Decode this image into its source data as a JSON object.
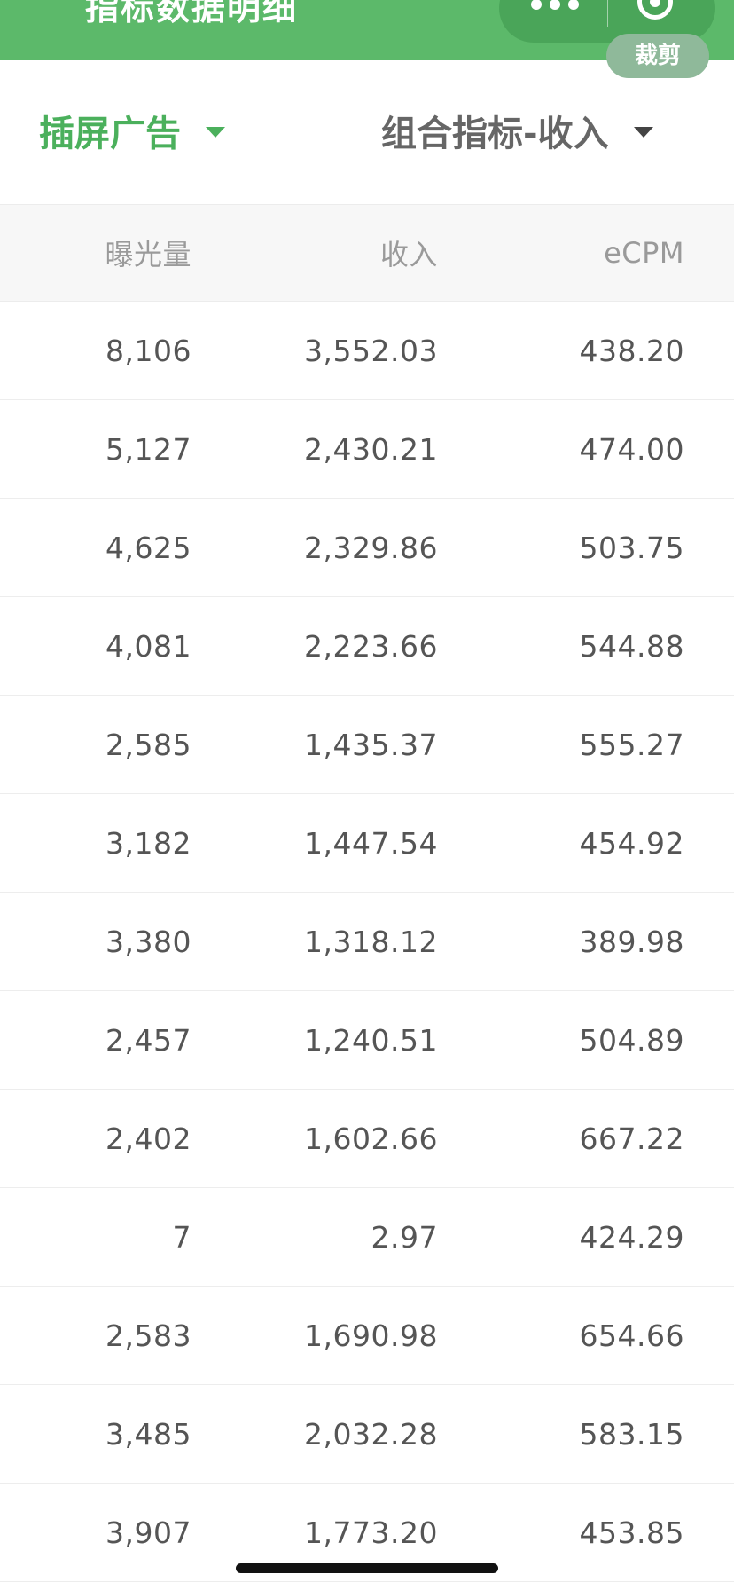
{
  "header": {
    "title": "指标数据明细",
    "crop_label": "裁剪"
  },
  "filters": {
    "ad_type": "插屏广告",
    "metric": "组合指标-收入"
  },
  "table": {
    "columns": [
      "曝光量",
      "收入",
      "eCPM"
    ],
    "rows": [
      [
        "8,106",
        "3,552.03",
        "438.20"
      ],
      [
        "5,127",
        "2,430.21",
        "474.00"
      ],
      [
        "4,625",
        "2,329.86",
        "503.75"
      ],
      [
        "4,081",
        "2,223.66",
        "544.88"
      ],
      [
        "2,585",
        "1,435.37",
        "555.27"
      ],
      [
        "3,182",
        "1,447.54",
        "454.92"
      ],
      [
        "3,380",
        "1,318.12",
        "389.98"
      ],
      [
        "2,457",
        "1,240.51",
        "504.89"
      ],
      [
        "2,402",
        "1,602.66",
        "667.22"
      ],
      [
        "7",
        "2.97",
        "424.29"
      ],
      [
        "2,583",
        "1,690.98",
        "654.66"
      ],
      [
        "3,485",
        "2,032.28",
        "583.15"
      ],
      [
        "3,907",
        "1,773.20",
        "453.85"
      ]
    ]
  },
  "colors": {
    "header_green": "#5cb96a",
    "accent_green": "#4bb05c",
    "text_gray": "#555555"
  },
  "icons": {
    "more": "more-dots-icon",
    "close": "mini-program-close-icon",
    "dropdown": "caret-down-icon"
  }
}
